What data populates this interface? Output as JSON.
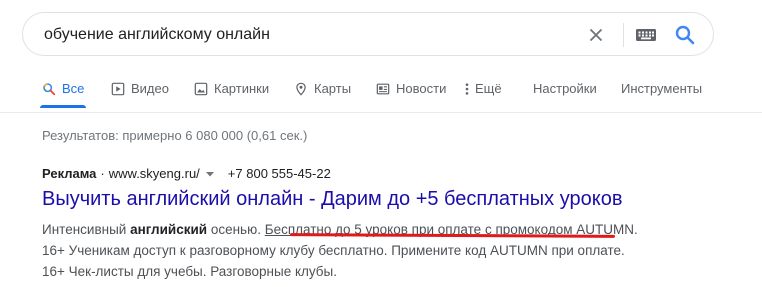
{
  "search": {
    "query": "обучение английскому онлайн"
  },
  "tabs": [
    {
      "label": "Все",
      "icon": "search-icon",
      "active": true
    },
    {
      "label": "Видео",
      "icon": "video-icon"
    },
    {
      "label": "Картинки",
      "icon": "image-icon"
    },
    {
      "label": "Карты",
      "icon": "map-pin-icon"
    },
    {
      "label": "Новости",
      "icon": "news-icon"
    },
    {
      "label": "Ещё",
      "icon": "more-vert-icon"
    },
    {
      "label": "Настройки"
    },
    {
      "label": "Инструменты"
    }
  ],
  "stats": "Результатов: примерно 6 080 000 (0,61 сек.)",
  "ad": {
    "label": "Реклама",
    "dot": "·",
    "url": "www.skyeng.ru/",
    "phone": "+7 800 555-45-22",
    "title": "Выучить английский онлайн - Дарим до +5 бесплатных уроков",
    "desc": {
      "p1": "Интенсивный ",
      "b1": "английский",
      "p2": " осенью. ",
      "u1": "Бесплатно до 5 уроков при оплате с промокодом",
      "p3": " AUTUMN. 16+ Ученикам доступ к разговорному клубу бесплатно. Примените код AUTUMN при оплате. 16+ Чек-листы для учебы. Разговорные клубы."
    }
  },
  "colors": {
    "link": "#1a0dab",
    "accent": "#1a73e8",
    "annotation": "#e0191b"
  }
}
